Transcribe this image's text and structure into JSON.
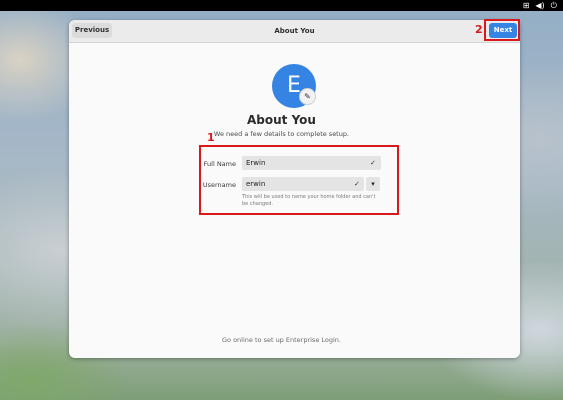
{
  "topbar": {
    "network_icon": "network-icon",
    "volume_icon": "volume-icon",
    "power_icon": "power-icon"
  },
  "header": {
    "previous_label": "Previous",
    "title": "About You",
    "next_label": "Next"
  },
  "annotations": {
    "form_label": "1",
    "next_label": "2",
    "color": "#d9191b"
  },
  "avatar": {
    "initial": "E",
    "edit_icon": "pencil-icon"
  },
  "main": {
    "title": "About You",
    "subtitle": "We need a few details to complete setup."
  },
  "form": {
    "full_name_label": "Full Name",
    "full_name_value": "Erwin",
    "username_label": "Username",
    "username_value": "erwin",
    "hint": "This will be used to name your home folder and can't be changed."
  },
  "footer": {
    "text": "Go online to set up Enterprise Login."
  },
  "colors": {
    "accent": "#3584e4"
  }
}
